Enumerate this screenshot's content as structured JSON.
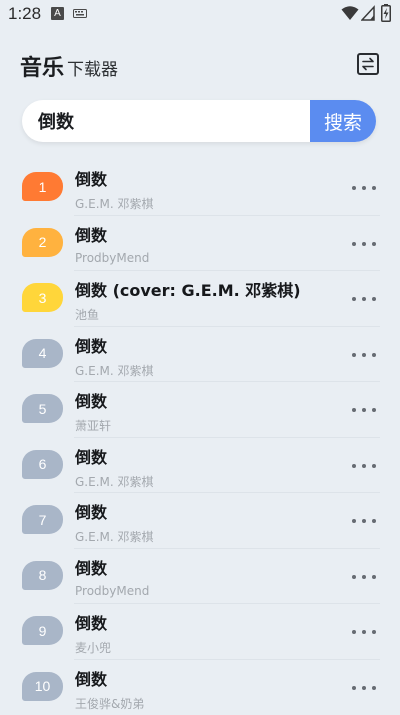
{
  "status_bar": {
    "time": "1:28",
    "notification_letter": "A"
  },
  "header": {
    "title": "音乐",
    "subtitle": "下载器"
  },
  "search": {
    "value": "倒数",
    "button_label": "搜索"
  },
  "colors": {
    "accent": "#5b8cf0",
    "rank_1": "#ff7a33",
    "rank_2": "#ffb23f",
    "rank_3": "#ffd63a",
    "rank_default": "#a9b6c8"
  },
  "songs": [
    {
      "rank": "1",
      "title": "倒数",
      "artist": "G.E.M. 邓紫棋"
    },
    {
      "rank": "2",
      "title": "倒数",
      "artist": "ProdbyMend"
    },
    {
      "rank": "3",
      "title": "倒数 (cover: G.E.M. 邓紫棋)",
      "artist": "池鱼"
    },
    {
      "rank": "4",
      "title": "倒数",
      "artist": "G.E.M. 邓紫棋"
    },
    {
      "rank": "5",
      "title": "倒数",
      "artist": "萧亚轩"
    },
    {
      "rank": "6",
      "title": "倒数",
      "artist": "G.E.M. 邓紫棋"
    },
    {
      "rank": "7",
      "title": "倒数",
      "artist": "G.E.M. 邓紫棋"
    },
    {
      "rank": "8",
      "title": "倒数",
      "artist": "ProdbyMend"
    },
    {
      "rank": "9",
      "title": "倒数",
      "artist": "麦小兜"
    },
    {
      "rank": "10",
      "title": "倒数",
      "artist": "王俊骅&奶弟"
    }
  ]
}
